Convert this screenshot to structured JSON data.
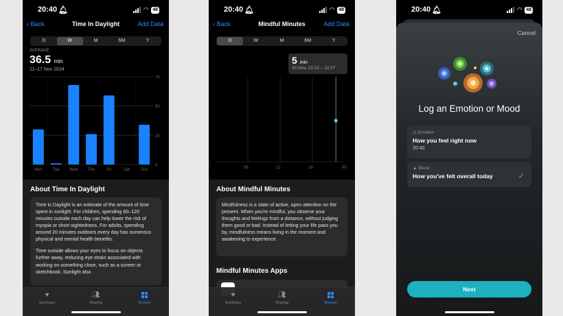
{
  "phone1": {
    "status": {
      "time": "20:40",
      "battery": "48"
    },
    "nav": {
      "back": "Back",
      "title": "Time In Daylight",
      "action": "Add Data"
    },
    "segments": [
      "D",
      "W",
      "M",
      "6M",
      "Y"
    ],
    "selected_segment": "W",
    "summary": {
      "label": "AVERAGE",
      "value": "36.5",
      "unit": "min",
      "date": "11–17 Nov 2024"
    },
    "chart_data": {
      "type": "bar",
      "categories": [
        "Mon",
        "Tue",
        "Wed",
        "Thu",
        "Fri",
        "Sat",
        "Sun"
      ],
      "values": [
        30,
        1,
        68,
        26,
        59,
        0,
        34
      ],
      "y_ticks": [
        "75",
        "50",
        "25",
        "0"
      ],
      "ylim": [
        0,
        75
      ],
      "bar_color": "#1a82ff",
      "grid": true
    },
    "about_title": "About Time In Daylight",
    "about_paragraphs": [
      "Time in Daylight is an estimate of the amount of time spent in sunlight. For children, spending 80–120 minutes outside each day can help lower the risk of myopia or short-sightedness. For adults, spending around 20 minutes outdoors every day has numerous physical and mental health benefits.",
      "Time outside allows your eyes to focus on objects further away, reducing eye strain associated with working on something close, such as a screen or sketchbook. Sunlight also"
    ]
  },
  "phone2": {
    "status": {
      "time": "20:40",
      "battery": "48"
    },
    "nav": {
      "back": "Back",
      "title": "Mindful Minutes",
      "action": "Add Data"
    },
    "segments": [
      "D",
      "W",
      "M",
      "6M",
      "Y"
    ],
    "selected_segment": "D",
    "tooltip": {
      "value": "5",
      "unit": "min",
      "date": "30 Nov, 22:22 – 22:27"
    },
    "chart_data": {
      "type": "scatter",
      "x_ticks": [
        "06",
        "12",
        "18",
        "00"
      ],
      "points": [
        {
          "x": "22:22",
          "y": 5
        }
      ],
      "point_color": "#5ac8fa",
      "grid": true
    },
    "about_title": "About Mindful Minutes",
    "about_text": "Mindfulness is a state of active, open attention on the present. When you're mindful, you observe your thoughts and feelings from a distance, without judging them good or bad. Instead of letting your life pass you by, mindfulness means living in the moment and awakening to experience.",
    "apps_title": "Mindful Minutes Apps"
  },
  "tabbar": {
    "tabs": [
      {
        "label": "Summary",
        "icon": "heart-icon"
      },
      {
        "label": "Sharing",
        "icon": "people-icon"
      },
      {
        "label": "Browse",
        "icon": "grid-icon"
      }
    ],
    "active_color": "#2d8cff"
  },
  "phone3": {
    "status": {
      "time": "20:40",
      "battery": "48"
    },
    "cancel": "Cancel",
    "title": "Log an Emotion or Mood",
    "options": [
      {
        "kind": "Emotion",
        "main": "How you feel right now",
        "sub": "20:40",
        "icon": "clock-icon"
      },
      {
        "kind": "Mood",
        "main": "How you've felt overall today",
        "icon": "mountain-icon",
        "checked": true
      }
    ],
    "next": "Next",
    "accent": "#1cb0c0"
  }
}
